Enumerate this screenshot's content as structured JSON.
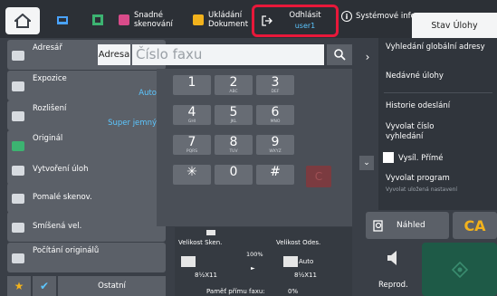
{
  "topbar": {
    "easy_scan": "Snadné\nskenování",
    "saved_docs": "Ukládání\nDokument",
    "logout_label": "Odhlásit",
    "logout_user": "user1",
    "sysinfo": "Systémové info.",
    "jobstatus": "Stav Úlohy"
  },
  "sidebar": {
    "items": [
      {
        "label": "Adresář",
        "value": ""
      },
      {
        "label": "Expozice",
        "value": "Auto"
      },
      {
        "label": "Rozlišení",
        "value": "Super jemný"
      },
      {
        "label": "Originál",
        "value": ""
      },
      {
        "label": "Vytvoření úloh",
        "value": ""
      },
      {
        "label": "Pomalé skenov.",
        "value": ""
      },
      {
        "label": "Smíšená vel.",
        "value": ""
      },
      {
        "label": "Počítání originálů",
        "value": ""
      }
    ],
    "other": "Ostatní"
  },
  "address": {
    "button": "Adresa",
    "fax_placeholder": "Číslo faxu"
  },
  "keypad": [
    {
      "k": "1",
      "s": ""
    },
    {
      "k": "2",
      "s": "ABC"
    },
    {
      "k": "3",
      "s": "DEF"
    },
    {
      "k": "4",
      "s": "GHI"
    },
    {
      "k": "5",
      "s": "JKL"
    },
    {
      "k": "6",
      "s": "MNO"
    },
    {
      "k": "7",
      "s": "PQRS"
    },
    {
      "k": "8",
      "s": "TUV"
    },
    {
      "k": "9",
      "s": "WXYZ"
    },
    {
      "k": "✳",
      "s": ""
    },
    {
      "k": "0",
      "s": ""
    },
    {
      "k": "#",
      "s": ""
    }
  ],
  "keypad_clear": "C",
  "info": {
    "scan_size_label": "Velikost Sken.",
    "send_size_label": "Velikost Odes.",
    "ratio": "100%",
    "send_size_value": "Auto",
    "scan_paper": "8½X11",
    "send_paper": "8½X11",
    "memory_label": "Paměť přímu faxu:",
    "memory_value": "0%"
  },
  "right_panel": {
    "global_search": "Vyhledání globální adresy",
    "recent_jobs": "Nedávné úlohy",
    "send_history": "Historie odeslání",
    "recall_number": "Vyvolat číslo vyhledání",
    "direct_send": "Vysíl. Přímé",
    "recall_program": "Vyvolat program",
    "recall_program_sub": "Vyvolat uložená nastavení"
  },
  "actions": {
    "preview": "Náhled",
    "ca": "CA",
    "reprod": "Reprod."
  },
  "colors": {
    "accent": "#5cc6ff",
    "highlight": "#e8183a",
    "ca": "#f2b21c",
    "start": "#1e5a47"
  }
}
